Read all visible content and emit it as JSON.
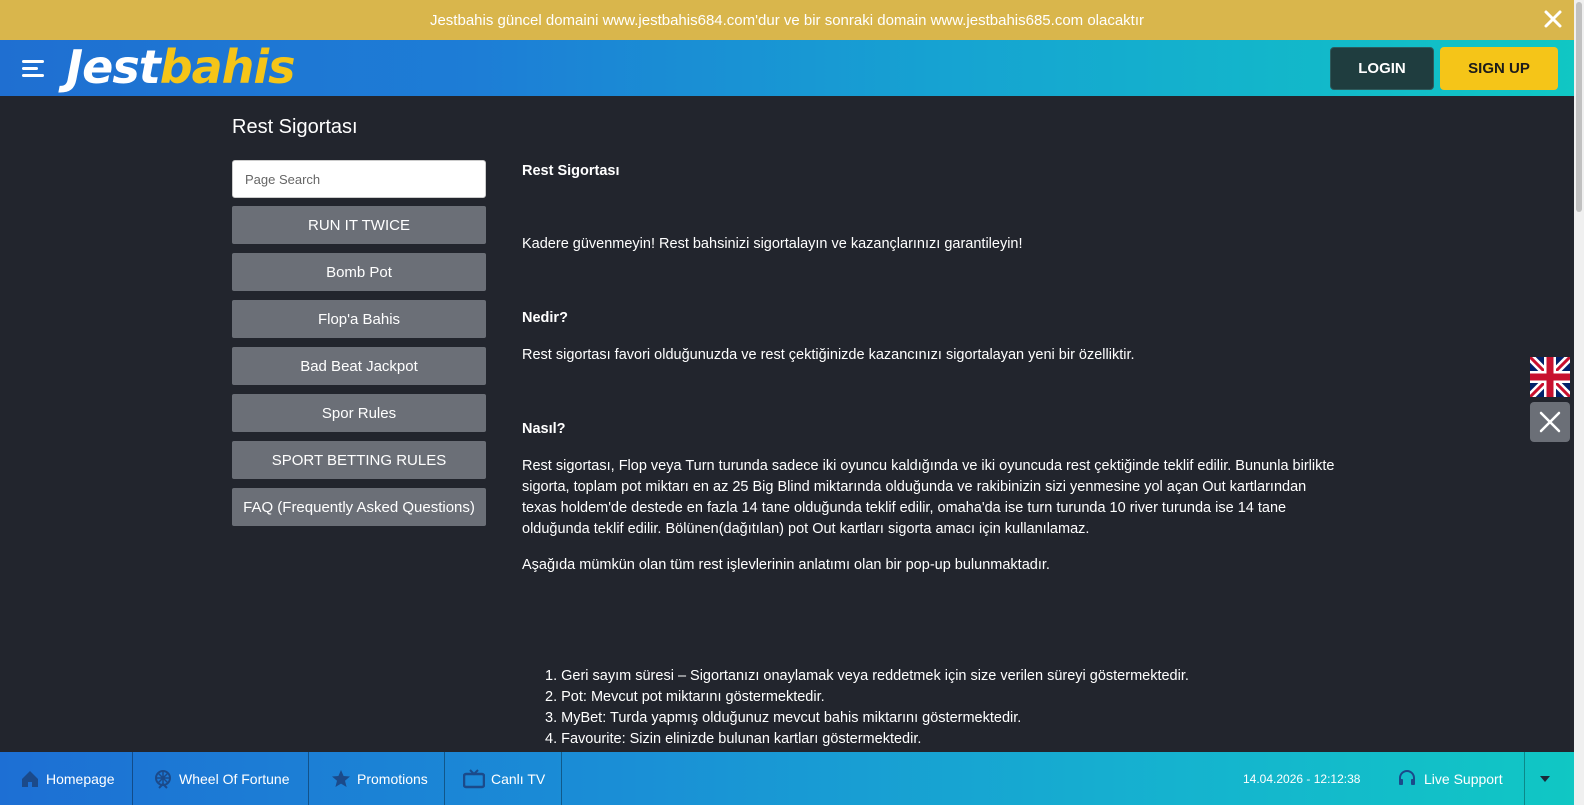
{
  "announcement": {
    "text": "Jestbahis güncel domaini www.jestbahis684.com'dur ve bir sonraki domain www.jestbahis685.com olacaktır"
  },
  "header": {
    "logo_part1": "Jest",
    "logo_part2": "bahis",
    "login_label": "LOGIN",
    "signup_label": "SIGN UP"
  },
  "page": {
    "title": "Rest Sigortası"
  },
  "search": {
    "placeholder": "Page Search",
    "value": ""
  },
  "sidebar": {
    "items": [
      {
        "label": "RUN IT TWICE"
      },
      {
        "label": "Bomb Pot"
      },
      {
        "label": "Flop'a Bahis"
      },
      {
        "label": "Bad Beat Jackpot"
      },
      {
        "label": "Spor Rules"
      },
      {
        "label": "SPORT BETTING RULES"
      },
      {
        "label": "FAQ (Frequently Asked Questions)"
      }
    ]
  },
  "article": {
    "heading": "Rest Sigortası",
    "intro": "Kadere güvenmeyin! Rest bahsinizi sigortalayın ve kazançlarınızı garantileyin!",
    "what_heading": "Nedir?",
    "what_text": "Rest sigortası favori olduğunuzda ve rest çektiğinizde kazancınızı sigortalayan yeni bir özelliktir.",
    "how_heading": "Nasıl?",
    "how_text": "Rest sigortası, Flop veya Turn turunda sadece iki oyuncu kaldığında ve iki oyuncuda rest çektiğinde teklif edilir. Bununla birlikte sigorta, toplam pot miktarı en az 25 Big Blind miktarında olduğunda ve rakibinizin sizi yenmesine yol açan Out kartlarından texas holdem'de destede en fazla 14 tane olduğunda teklif edilir, omaha'da ise turn turunda 10 river turunda ise 14 tane olduğunda teklif edilir. Bölünen(dağıtılan) pot Out kartları sigorta amacı için kullanılamaz.",
    "popup_text": "Aşağıda mümkün olan tüm rest işlevlerinin anlatımı olan bir pop-up bulunmaktadır.",
    "list": [
      "1. Geri sayım süresi – Sigortanızı onaylamak veya reddetmek için size verilen süreyi göstermektedir.",
      "2. Pot: Mevcut pot miktarını göstermektedir.",
      "3. MyBet: Turda yapmış olduğunuz mevcut bahis miktarını göstermektedir.",
      "4. Favourite: Sizin elinizde bulunan kartları göstermektedir."
    ]
  },
  "footer": {
    "items": [
      {
        "label": "Homepage",
        "icon": "home-icon"
      },
      {
        "label": "Wheel Of Fortune",
        "icon": "wheel-icon"
      },
      {
        "label": "Promotions",
        "icon": "star-icon"
      },
      {
        "label": "Canlı TV",
        "icon": "tv-icon"
      }
    ],
    "datetime": "14.04.2026 - 12:12:38",
    "live_support": "Live Support"
  },
  "colors": {
    "announcement_bg": "#d9b64c",
    "page_bg": "#22252d",
    "sidebar_button": "#6b6f77",
    "signup_yellow": "#f5c518",
    "login_dark": "#1f3d3f"
  }
}
